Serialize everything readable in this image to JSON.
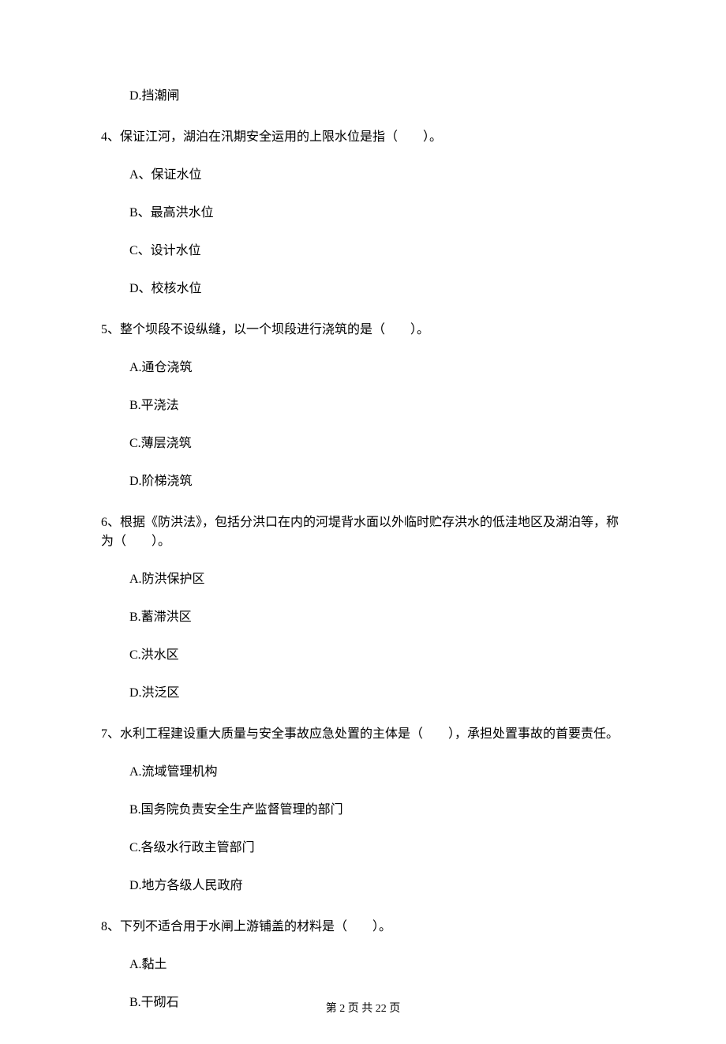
{
  "questions": [
    {
      "text": "",
      "options": [
        "D.挡潮闸"
      ]
    },
    {
      "text": "4、保证江河，湖泊在汛期安全运用的上限水位是指（　　）。",
      "options": [
        "A、保证水位",
        "B、最高洪水位",
        "C、设计水位",
        "D、校核水位"
      ]
    },
    {
      "text": "5、整个坝段不设纵缝，以一个坝段进行浇筑的是（　　）。",
      "options": [
        "A.通仓浇筑",
        "B.平浇法",
        "C.薄层浇筑",
        "D.阶梯浇筑"
      ]
    },
    {
      "text": "6、根据《防洪法》，包括分洪口在内的河堤背水面以外临时贮存洪水的低洼地区及湖泊等，称为（　　）。",
      "options": [
        "A.防洪保护区",
        "B.蓄滞洪区",
        "C.洪水区",
        "D.洪泛区"
      ]
    },
    {
      "text": "7、水利工程建设重大质量与安全事故应急处置的主体是（　　），承担处置事故的首要责任。",
      "options": [
        "A.流域管理机构",
        "B.国务院负责安全生产监督管理的部门",
        "C.各级水行政主管部门",
        "D.地方各级人民政府"
      ]
    },
    {
      "text": "8、下列不适合用于水闸上游铺盖的材料是（　　）。",
      "options": [
        "A.黏土",
        "B.干砌石"
      ]
    }
  ],
  "footer": "第 2 页 共 22 页"
}
